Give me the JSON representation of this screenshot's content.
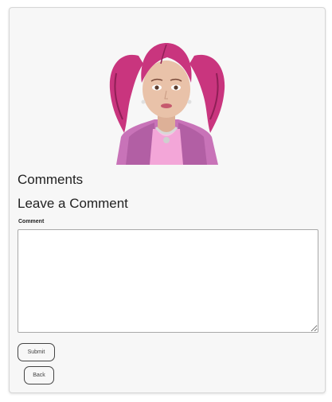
{
  "avatar": {
    "alt": "3D character with pink pigtails",
    "colors": {
      "hair": "#c9357e",
      "skin": "#e9c2a9",
      "jacket": "#c873b8",
      "shirt": "#f3a6d8"
    }
  },
  "comments_heading": "Comments",
  "leave_comment_heading": "Leave a Comment",
  "form": {
    "comment_label": "Comment",
    "comment_value": "",
    "comment_placeholder": "",
    "submit_label": "Submit",
    "back_label": "Back"
  }
}
